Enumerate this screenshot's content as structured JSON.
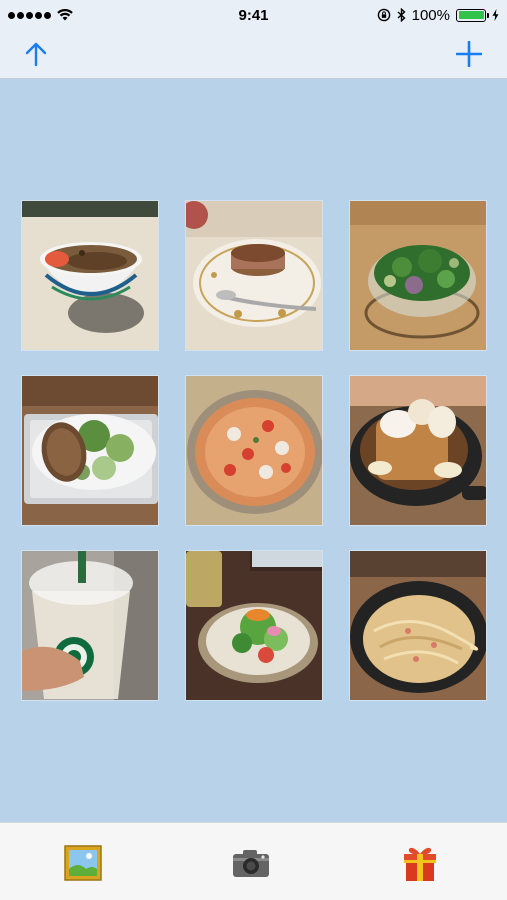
{
  "status_bar": {
    "time": "9:41",
    "battery_text": "100%",
    "battery_color": "#33c24a"
  },
  "nav_bar": {
    "left_icon": "arrow-up-icon",
    "right_icon": "plus-icon",
    "tint_color": "#1a7cf5"
  },
  "photos": [
    {
      "name": "photo-gyudon-bowl",
      "icon": "gyudon-bowl"
    },
    {
      "name": "photo-pudding-plate",
      "icon": "pudding-plate"
    },
    {
      "name": "photo-green-salad-bowl",
      "icon": "salad-bowl"
    },
    {
      "name": "photo-salad-with-bread",
      "icon": "salad-bread"
    },
    {
      "name": "photo-pizza",
      "icon": "pizza"
    },
    {
      "name": "photo-french-toast-skillet",
      "icon": "french-toast"
    },
    {
      "name": "photo-starbucks-frappuccino",
      "icon": "starbucks-cup"
    },
    {
      "name": "photo-salad-plate-with-drink",
      "icon": "salad-plate"
    },
    {
      "name": "photo-pasta-skillet",
      "icon": "pasta"
    }
  ],
  "tab_bar": {
    "items": [
      "photo-library-icon",
      "camera-icon",
      "gift-icon"
    ]
  }
}
